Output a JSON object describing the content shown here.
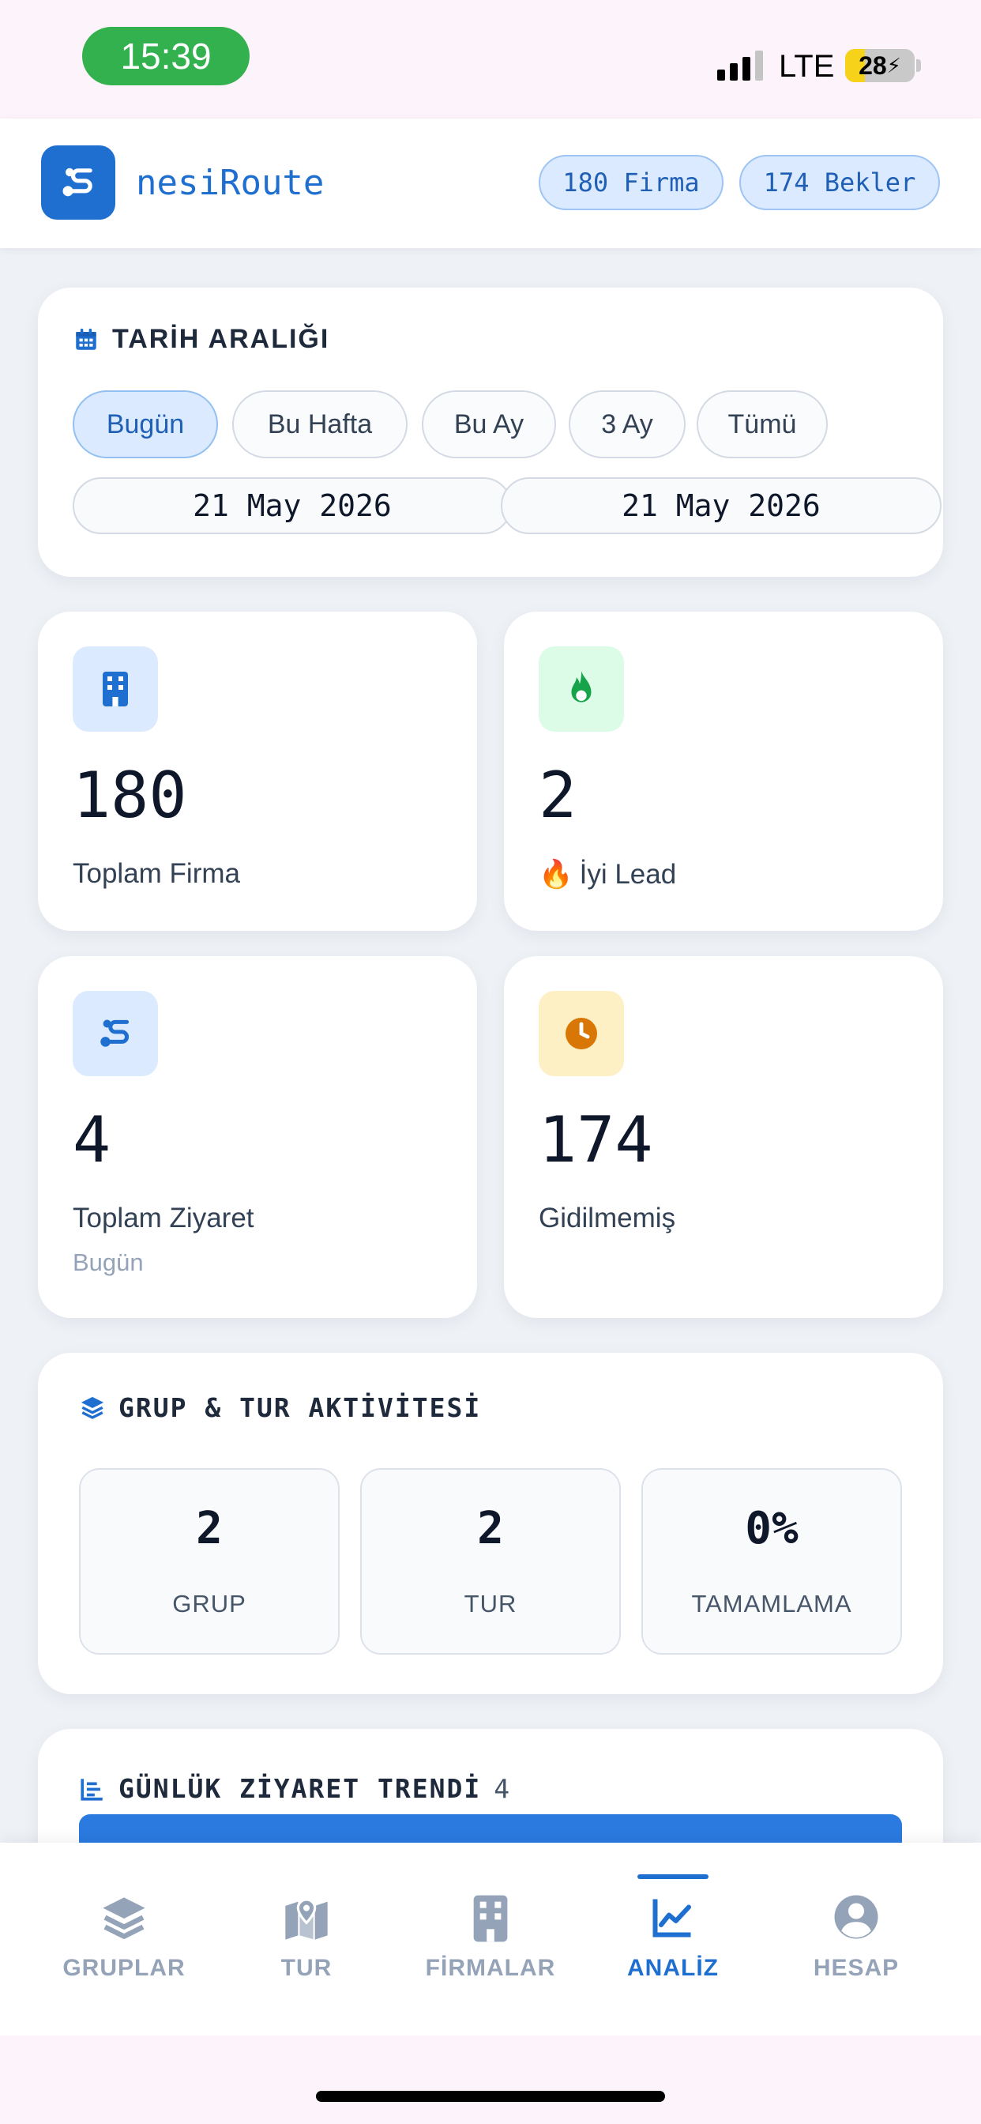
{
  "status_bar": {
    "time": "15:39",
    "network": "LTE",
    "battery_level": "28",
    "battery_fraction": 0.28
  },
  "header": {
    "app_name": "nesiRoute",
    "firm_count_badge": "180 Firma",
    "pending_badge": "174 Bekler"
  },
  "date_range": {
    "title": "TARİH ARALIĞI",
    "presets": [
      "Bugün",
      "Bu Hafta",
      "Bu Ay",
      "3 Ay",
      "Tümü"
    ],
    "active_preset": "Bugün",
    "start_date": "21 May 2026",
    "end_date": "21 May 2026"
  },
  "stats": {
    "total_firms": {
      "value": "180",
      "label": "Toplam Firma"
    },
    "good_leads": {
      "value": "2",
      "emoji": "🔥",
      "label": "İyi Lead"
    },
    "total_visits": {
      "value": "4",
      "label": "Toplam Ziyaret",
      "sublabel": "Bugün"
    },
    "not_visited": {
      "value": "174",
      "label": "Gidilmemiş"
    }
  },
  "group_tour": {
    "title": "GRUP & TUR AKTİVİTESİ",
    "items": [
      {
        "value": "2",
        "label": "GRUP"
      },
      {
        "value": "2",
        "label": "TUR"
      },
      {
        "value": "0%",
        "label": "TAMAMLAMA"
      }
    ]
  },
  "daily_trend": {
    "title": "GÜNLÜK ZİYARET TRENDİ",
    "count": "4"
  },
  "bottom_nav": {
    "items": [
      "GRUPLAR",
      "TUR",
      "FİRMALAR",
      "ANALİZ",
      "HESAP"
    ],
    "active": "ANALİZ"
  },
  "colors": {
    "primary": "#1f6fd1",
    "status_green": "#34b14f",
    "lead_green": "#16a34a",
    "pending_orange": "#d97706",
    "battery_yellow": "#f7d21a"
  }
}
